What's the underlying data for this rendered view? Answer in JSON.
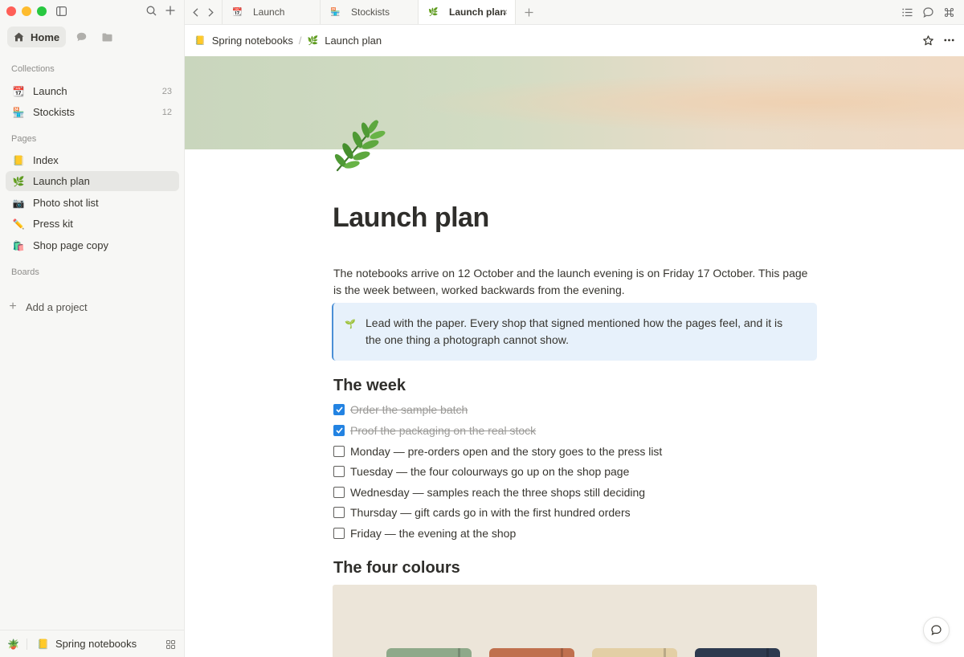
{
  "sidebar": {
    "home_label": "Home",
    "sections": {
      "collections": "Collections",
      "pages": "Pages",
      "boards": "Boards"
    },
    "collections": [
      {
        "emoji": "📆",
        "label": "Launch",
        "count": "23"
      },
      {
        "emoji": "🏪",
        "label": "Stockists",
        "count": "12"
      }
    ],
    "pages": [
      {
        "emoji": "📒",
        "label": "Index"
      },
      {
        "emoji": "🌿",
        "label": "Launch plan"
      },
      {
        "emoji": "📷",
        "label": "Photo shot list"
      },
      {
        "emoji": "✏️",
        "label": "Press kit"
      },
      {
        "emoji": "🛍️",
        "label": "Shop page copy"
      }
    ],
    "add_project": "Add a project",
    "footer": {
      "plant_emoji": "🪴",
      "workspace_emoji": "📒",
      "workspace_name": "Spring notebooks"
    }
  },
  "tabs": [
    {
      "emoji": "📆",
      "label": "Launch"
    },
    {
      "emoji": "🏪",
      "label": "Stockists"
    },
    {
      "emoji": "🌿",
      "label": "Launch plan",
      "active": true,
      "close": "×"
    }
  ],
  "breadcrumb": [
    {
      "emoji": "📒",
      "label": "Spring notebooks"
    },
    {
      "emoji": "🌿",
      "label": "Launch plan"
    }
  ],
  "page": {
    "title": "Launch plan",
    "intro": "The notebooks arrive on 12 October and the launch evening is on Friday 17 October. This page is the week between, worked backwards from the evening.",
    "callout": {
      "emoji": "🌱",
      "text": "Lead with the paper. Every shop that signed mentioned how the pages feel, and it is the one thing a photograph cannot show."
    },
    "week_heading": "The week",
    "todos": [
      {
        "text": "Order the sample batch",
        "done": true
      },
      {
        "text": "Proof the packaging on the real stock",
        "done": true
      },
      {
        "text": "Monday — pre-orders open and the story goes to the press list",
        "done": false
      },
      {
        "text": "Tuesday — the four colourways go up on the shop page",
        "done": false
      },
      {
        "text": "Wednesday — samples reach the three shops still deciding",
        "done": false
      },
      {
        "text": "Thursday — gift cards go in with the first hundred orders",
        "done": false
      },
      {
        "text": "Friday — the evening at the shop",
        "done": false
      }
    ],
    "colours_heading": "The four colours",
    "notebook_colors": [
      "#8fa98a",
      "#c0704e",
      "#e3cfa5",
      "#2d3a4f"
    ]
  },
  "colors": {
    "accent": "#2383e2",
    "callout_bg": "#e7f1fb",
    "callout_border": "#4a8fd6"
  }
}
